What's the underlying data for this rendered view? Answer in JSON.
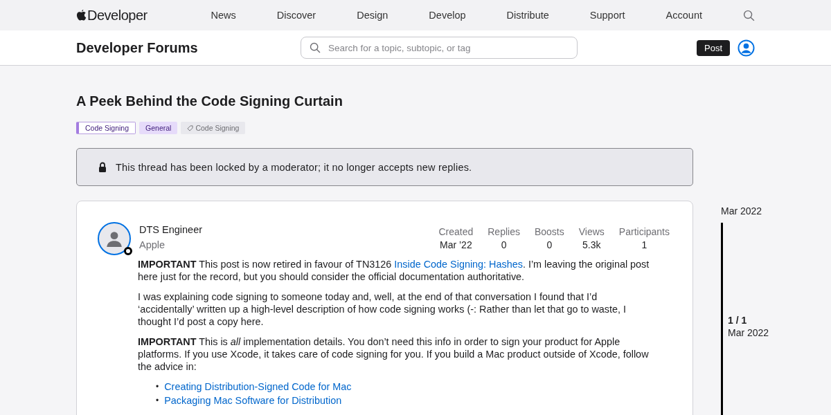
{
  "global_nav": {
    "brand": "Developer",
    "items": [
      "News",
      "Discover",
      "Design",
      "Develop",
      "Distribute",
      "Support",
      "Account"
    ]
  },
  "forum_bar": {
    "title": "Developer Forums",
    "search": {
      "placeholder": "Search for a topic, subtopic, or tag"
    },
    "post_button": "Post"
  },
  "thread": {
    "title": "A Peek Behind the Code Signing Curtain",
    "tags": [
      {
        "kind": "topic",
        "label": "Code Signing"
      },
      {
        "kind": "subtopic",
        "label": "General"
      },
      {
        "kind": "tag",
        "label": "Code Signing"
      }
    ],
    "lock_notice": "This thread has been locked by a moderator; it no longer accepts new replies."
  },
  "post": {
    "author": "DTS Engineer",
    "affiliation": "Apple",
    "stats": [
      {
        "label": "Created",
        "value": "Mar ’22"
      },
      {
        "label": "Replies",
        "value": "0"
      },
      {
        "label": "Boosts",
        "value": "0"
      },
      {
        "label": "Views",
        "value": "5.3k"
      },
      {
        "label": "Participants",
        "value": "1"
      }
    ],
    "paragraphs": [
      {
        "text": "**IMPORTANT** This post is now retired in favour of TN3126 ",
        "link": "Inside Code Signing: Hashes",
        "after": ". I’m leaving the original post here just for the record, but you should consider the official documentation authoritative."
      },
      {
        "text": "I was explaining code signing to someone today and, well, at the end of that conversation I found that I’d ‘accidentally’ written up a high-level description of how code signing works (-: Rather than let that go to waste, I thought I’d post a copy here."
      },
      {
        "text": "**IMPORTANT** This is *all* implementation details. You don’t need this info in order to sign your product for Apple platforms. If you use Xcode, it takes care of code signing for you. If you build a Mac product outside of Xcode, follow the advice in:"
      }
    ],
    "links": [
      {
        "marker": "•",
        "text": "Creating Distribution-Signed Code for Mac"
      },
      {
        "marker": "•",
        "text": "Packaging Mac Software for Distribution"
      }
    ]
  },
  "timeline": {
    "start": "Mar 2022",
    "position": "1 / 1",
    "current": "Mar 2022"
  }
}
